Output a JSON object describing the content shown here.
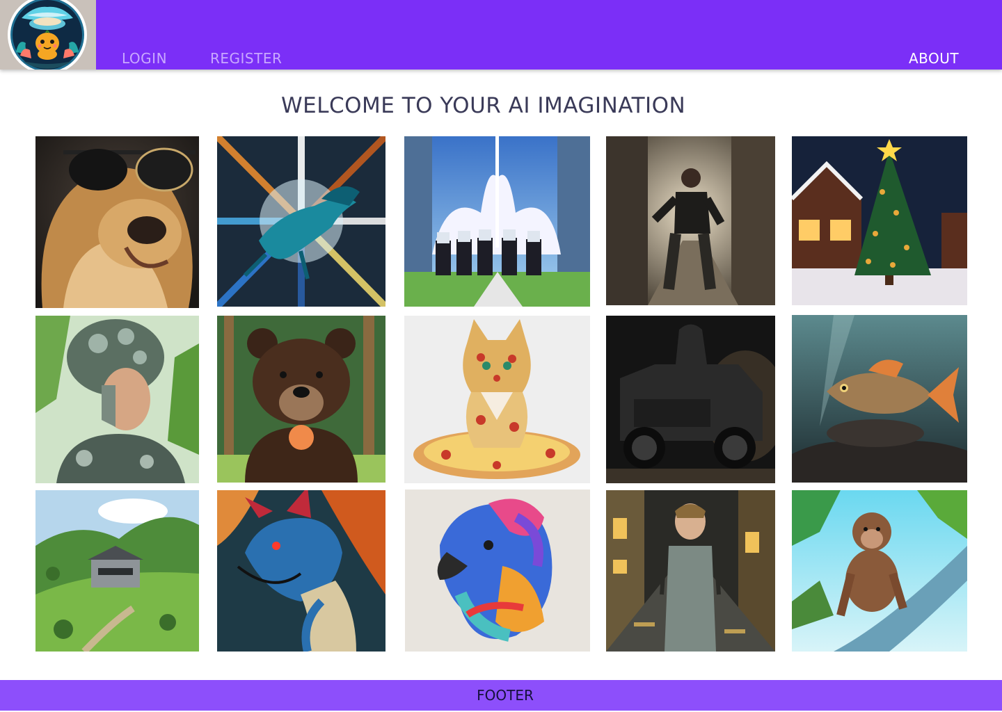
{
  "nav": {
    "login": "LOGIN",
    "register": "REGISTER",
    "about": "ABOUT"
  },
  "page": {
    "title": "WELCOME TO YOUR AI IMAGINATION"
  },
  "gallery": [
    {
      "subject": "dog-with-sunglasses"
    },
    {
      "subject": "blue-dragon-speed-burst"
    },
    {
      "subject": "riders-on-horses-anime-city"
    },
    {
      "subject": "man-running-ruined-street"
    },
    {
      "subject": "christmas-tree-cabin-night"
    },
    {
      "subject": "cyborg-woman-plants-gears"
    },
    {
      "subject": "bear-eating-flower-forest"
    },
    {
      "subject": "pizza-cat"
    },
    {
      "subject": "dark-jeep-hooded-figure"
    },
    {
      "subject": "fish-underwater-ruins"
    },
    {
      "subject": "house-on-green-hill"
    },
    {
      "subject": "blue-dragon-portrait"
    },
    {
      "subject": "rainbow-smoke-dog"
    },
    {
      "subject": "boy-in-rainy-street"
    },
    {
      "subject": "monkey-on-tree-branch"
    }
  ],
  "footer": {
    "label": "FOOTER"
  },
  "colors": {
    "header": "#7b2ff7",
    "footer": "#8d4ffb",
    "title": "#3a3a58"
  }
}
